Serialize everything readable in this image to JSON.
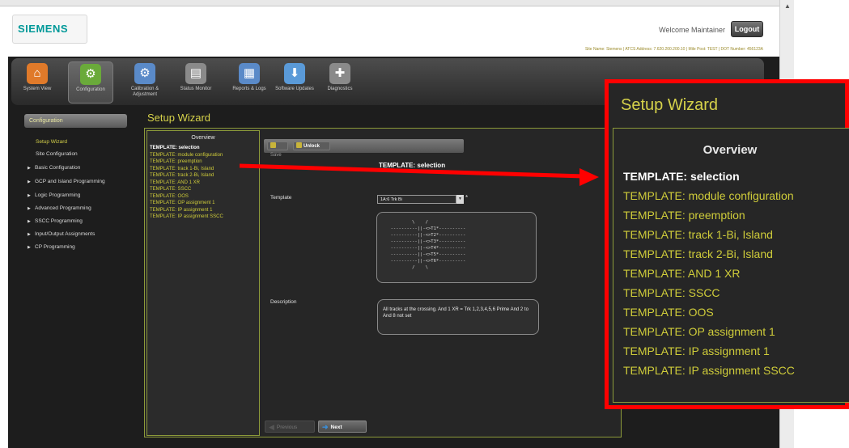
{
  "header": {
    "logo": "SIEMENS",
    "welcome": "Welcome Maintainer",
    "logout_label": "Logout",
    "site_info": "Site Name: Siemens | ATCS Address: 7.620.200.200.10 | Mile Post: TEST | DOT Number: 456123A"
  },
  "nav": [
    {
      "label": "System View",
      "icon": "house-icon",
      "color": "#e07a2a"
    },
    {
      "label": "Configuration",
      "icon": "gears-icon",
      "color": "#6aaa3a"
    },
    {
      "label": "Calibration & Adjustment",
      "icon": "calibration-gears-icon",
      "color": "#5a8ac8"
    },
    {
      "label": "Status Monitor",
      "icon": "monitor-icon",
      "color": "#9a9a9a"
    },
    {
      "label": "Reports & Logs",
      "icon": "report-icon",
      "color": "#5a8ac8"
    },
    {
      "label": "Software Updates",
      "icon": "download-icon",
      "color": "#5a9ad8"
    },
    {
      "label": "Diagnostics",
      "icon": "diagnostics-icon",
      "color": "#9a9a9a"
    }
  ],
  "sidebar": {
    "header": "Configuration",
    "items": [
      {
        "label": "Setup Wizard"
      },
      {
        "label": "Site Configuration"
      },
      {
        "label": "Basic Configuration"
      },
      {
        "label": "GCP and Island Programming"
      },
      {
        "label": "Logic Programming"
      },
      {
        "label": "Advanced Programming"
      },
      {
        "label": "SSCC Programming"
      },
      {
        "label": "Input/Output Assignments"
      },
      {
        "label": "CP Programming"
      }
    ]
  },
  "wizard": {
    "title": "Setup Wizard",
    "overview_title": "Overview",
    "overview_items": [
      "TEMPLATE: selection",
      "TEMPLATE: module configuration",
      "TEMPLATE: preemption",
      "TEMPLATE: track 1-Bi, Island",
      "TEMPLATE: track 2-Bi, Island",
      "TEMPLATE: AND 1 XR",
      "TEMPLATE: SSCC",
      "TEMPLATE: OOS",
      "TEMPLATE: OP assignment 1",
      "TEMPLATE: IP assignment 1",
      "TEMPLATE: IP assignment SSCC"
    ],
    "save_label": "Save",
    "unlock_label": "Unlock",
    "content_title": "TEMPLATE: selection",
    "template_label": "Template",
    "template_value": "1A:6 Trk Bi",
    "required_mark": "*",
    "diagram_lines": [
      "          \\    /",
      "  ----------||-<>T1*----------",
      "  ----------||-<>T2*----------",
      "  ----------||-<>T3*----------",
      "  ----------||-<>T4*----------",
      "  ----------||-<>T5*----------",
      "  ----------||-<>T6*----------",
      "          /    \\"
    ],
    "description_label": "Description",
    "description_text": "All tracks at the crossing. And 1 XR = Trk 1,2,3,4,5,6 Prime And 2 to And 8 not set",
    "previous_label": "Previous",
    "next_label": "Next"
  },
  "zoom": {
    "title": "Setup Wizard",
    "overview_title": "Overview",
    "items": [
      "TEMPLATE: selection",
      "TEMPLATE: module configuration",
      "TEMPLATE: preemption",
      "TEMPLATE: track 1-Bi, Island",
      "TEMPLATE: track 2-Bi, Island",
      "TEMPLATE: AND 1 XR",
      "TEMPLATE: SSCC",
      "TEMPLATE: OOS",
      "TEMPLATE: OP assignment 1",
      "TEMPLATE: IP assignment 1",
      "TEMPLATE: IP assignment SSCC"
    ]
  }
}
